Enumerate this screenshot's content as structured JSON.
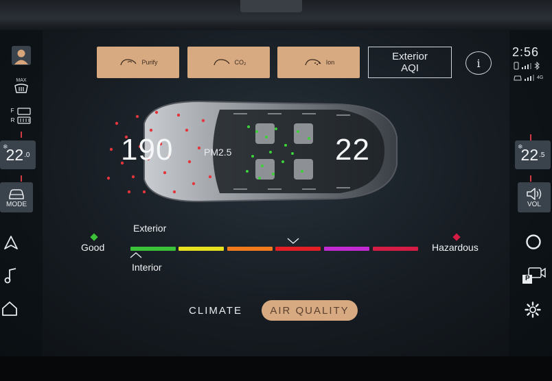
{
  "top_buttons": [
    {
      "label": "Purify",
      "icon": "car-purify-icon"
    },
    {
      "label": "CO₂",
      "icon": "car-co2-icon"
    },
    {
      "label": "Ion",
      "icon": "car-ion-icon"
    }
  ],
  "exterior_aqi": {
    "line1": "Exterior",
    "line2": "AQI"
  },
  "info_label": "i",
  "status": {
    "time": "2:56",
    "network": "4G"
  },
  "left_sidebar": {
    "max_label": "MAX",
    "front_label": "F",
    "rear_label": "R",
    "temp_whole": "22",
    "temp_decimal": ".0",
    "mode_label": "MODE"
  },
  "right_sidebar": {
    "temp_whole": "22",
    "temp_decimal": ".5",
    "vol_label": "VOL",
    "park_label": "P"
  },
  "readings": {
    "exterior_value": "190",
    "pm_label": "PM2.5",
    "interior_value": "22",
    "exterior_aqi_fraction_on_scale": 0.58,
    "interior_aqi_fraction_on_scale": 0.03
  },
  "scale": {
    "exterior_label": "Exterior",
    "interior_label": "Interior",
    "good_label": "Good",
    "hazardous_label": "Hazardous",
    "colors": [
      "#3cc23a",
      "#e6e21f",
      "#f07a1c",
      "#e21f24",
      "#c22ad2",
      "#d41c44"
    ],
    "good_color": "#3cc23a",
    "hazard_color": "#d41c44"
  },
  "tabs": {
    "climate": "CLIMATE",
    "air_quality": "AIR QUALITY",
    "active": "air_quality"
  },
  "colors": {
    "accent": "#d8aa82",
    "warning_red": "#d23a46"
  }
}
